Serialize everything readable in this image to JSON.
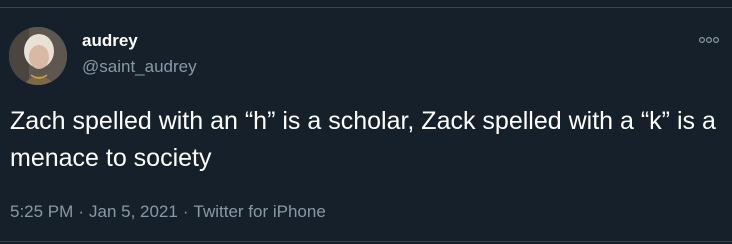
{
  "tweet": {
    "author": {
      "display_name": "audrey",
      "handle": "@saint_audrey"
    },
    "text": "Zach spelled with an “h” is a scholar, Zack spelled with a “k” is a menace to society",
    "timestamp": "5:25 PM",
    "date": "Jan 5, 2021",
    "separator": "·",
    "source": "Twitter for iPhone"
  },
  "icons": {
    "more": "more-options-icon",
    "avatar": "avatar"
  },
  "colors": {
    "background": "#15202b",
    "text_primary": "#ffffff",
    "text_secondary": "#8899a6",
    "divider": "#38444d"
  }
}
